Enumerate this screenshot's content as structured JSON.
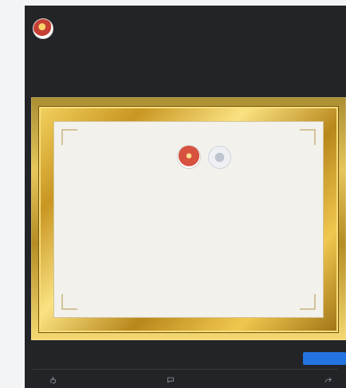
{
  "post": {
    "page_name": "",
    "page_subtitle": "",
    "meta_line1": "",
    "meta_line2": "",
    "caption": {
      "line1": "",
      "line2": ""
    }
  },
  "certificate": {
    "heading": "",
    "subheading": "",
    "recipient_name": "",
    "body": [
      "",
      "",
      "",
      "",
      ""
    ],
    "date": "",
    "signature": "",
    "role": ""
  },
  "footer": {
    "link_label": "",
    "cta_label": ""
  },
  "actions": {
    "like": "",
    "comment": "",
    "share": ""
  },
  "icons": {
    "like": "thumbs-up-icon",
    "comment": "comment-icon",
    "share": "share-icon"
  },
  "colors": {
    "card_background": "#232428",
    "accent_blue": "#2374e1",
    "link_blue": "#72a7ff",
    "frame_gold": "#d9b54a"
  }
}
